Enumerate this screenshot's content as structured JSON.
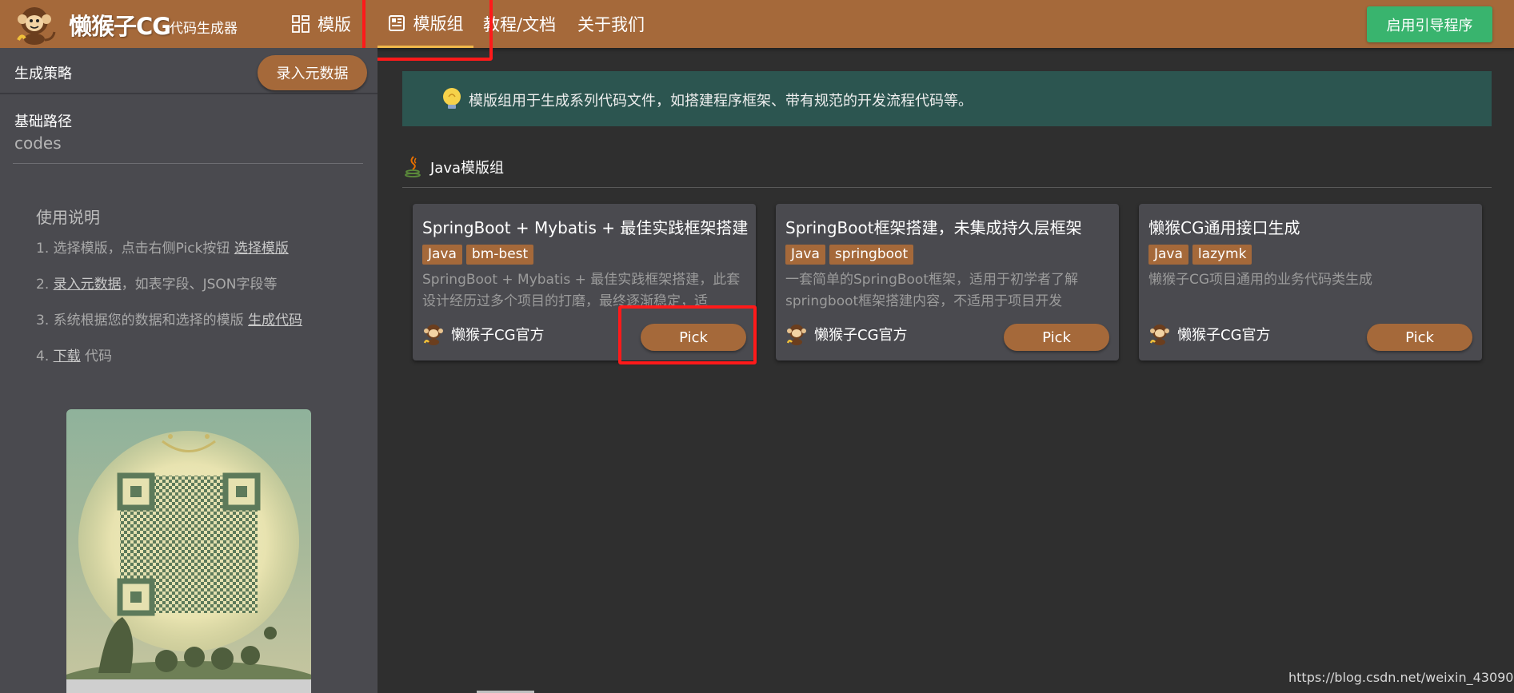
{
  "header": {
    "brand": "懒猴子CG",
    "brand_sub": "代码生成器",
    "nav": [
      {
        "label": "模版"
      },
      {
        "label": "模版组"
      },
      {
        "label": "教程/文档"
      },
      {
        "label": "关于我们"
      }
    ],
    "guide_button": "启用引导程序"
  },
  "sidebar": {
    "strategy_label": "生成策略",
    "meta_button": "录入元数据",
    "base_path_label": "基础路径",
    "base_path_value": "codes",
    "usage": {
      "title": "使用说明",
      "step1_prefix": "1. 选择模版，点击右侧Pick按钮 ",
      "step1_link": "选择模版",
      "step2_prefix": "2. ",
      "step2_link": "录入元数据",
      "step2_suffix": "，如表字段、JSON字段等",
      "step3_prefix": "3. 系统根据您的数据和选择的模版 ",
      "step3_link": "生成代码",
      "step4_prefix": "4. ",
      "step4_link": "下载",
      "step4_suffix": " 代码"
    }
  },
  "main": {
    "notice": "模版组用于生成系列代码文件，如搭建程序框架、带有规范的开发流程代码等。",
    "group_title": "Java模版组",
    "cards": [
      {
        "title": "SpringBoot + Mybatis + 最佳实践框架搭建",
        "tags": [
          "Java",
          "bm-best"
        ],
        "desc": "SpringBoot + Mybatis + 最佳实践框架搭建，此套设计经历过多个项目的打磨，最终逐渐稳定，适",
        "author": "懒猴子CG官方",
        "pick": "Pick"
      },
      {
        "title": "SpringBoot框架搭建，未集成持久层框架",
        "tags": [
          "Java",
          "springboot"
        ],
        "desc": "一套简单的SpringBoot框架，适用于初学者了解springboot框架搭建内容，不适用于项目开发",
        "author": "懒猴子CG官方",
        "pick": "Pick"
      },
      {
        "title": "懒猴CG通用接口生成",
        "tags": [
          "Java",
          "lazymk"
        ],
        "desc": "懒猴子CG项目通用的业务代码类生成",
        "author": "懒猴子CG官方",
        "pick": "Pick"
      }
    ]
  },
  "watermark": "https://blog.csdn.net/weixin_43090140",
  "colors": {
    "header": "#a5693a",
    "accent_underline": "#f0b84b",
    "guide_button": "#39b46e",
    "highlight_box": "#ff1a1a",
    "notice_bg": "#2c5550"
  }
}
